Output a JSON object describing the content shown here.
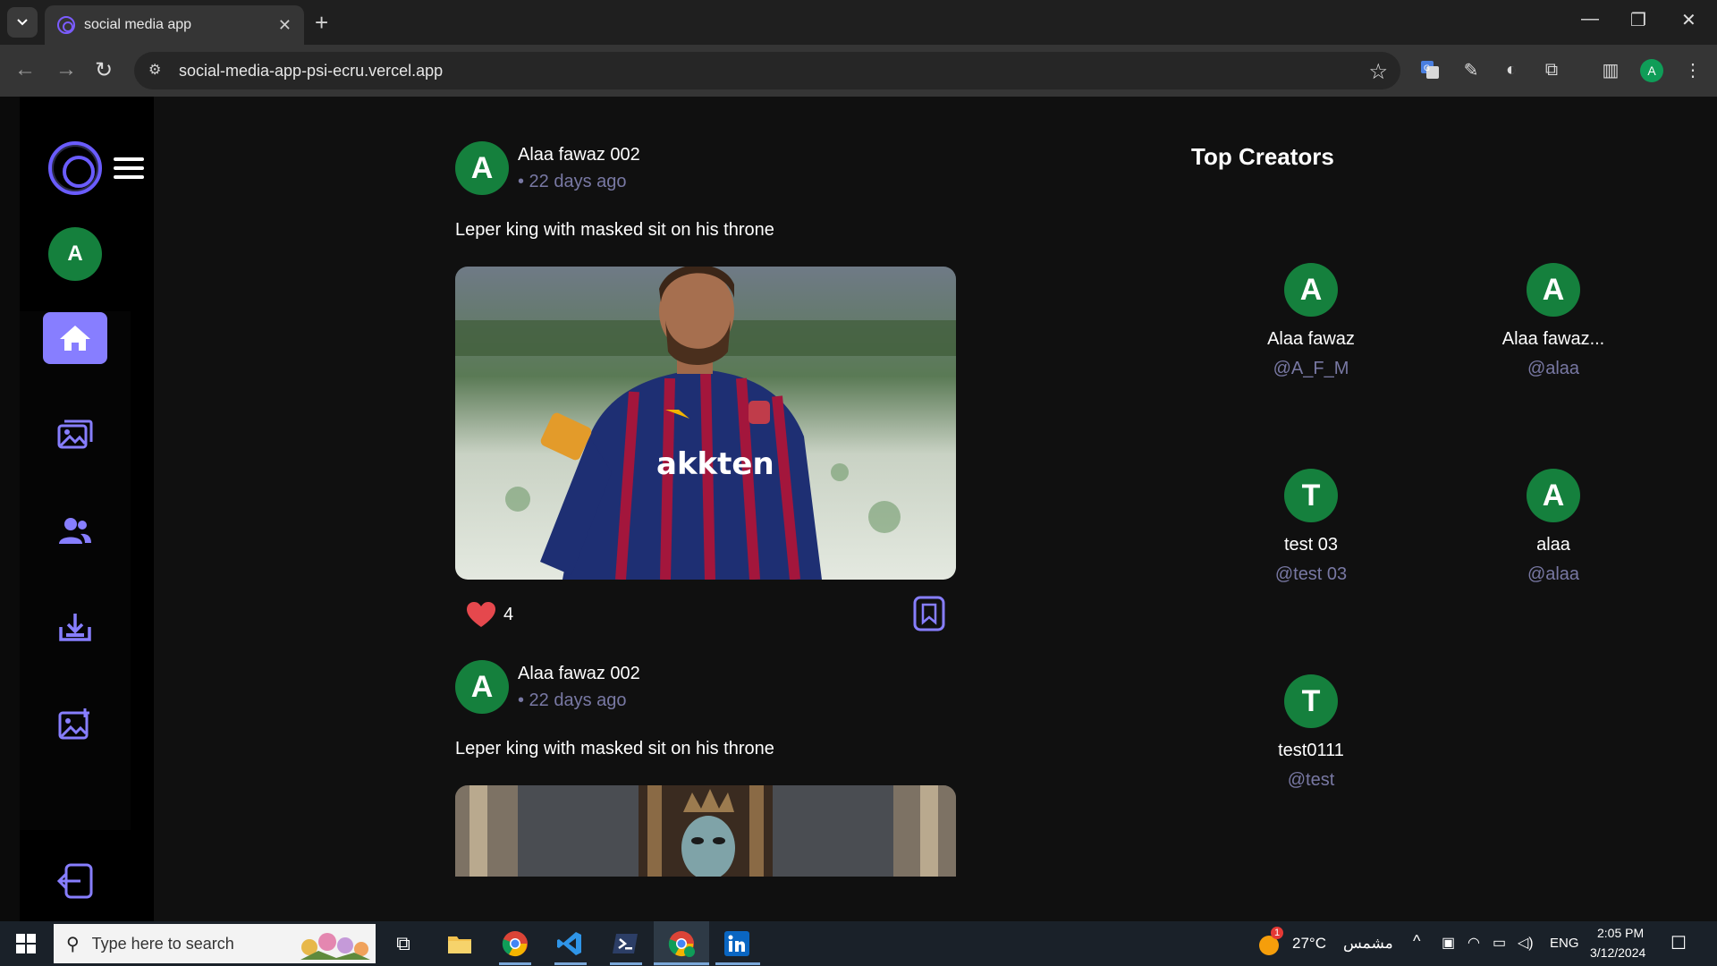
{
  "browser": {
    "tab_title": "social media app",
    "url": "social-media-app-psi-ecru.vercel.app",
    "profile_initial": "A"
  },
  "sidebar": {
    "user_initial": "A",
    "nav_items": [
      {
        "name": "home",
        "icon": "home-icon",
        "active": true
      },
      {
        "name": "explore",
        "icon": "gallery-icon",
        "active": false
      },
      {
        "name": "people",
        "icon": "people-icon",
        "active": false
      },
      {
        "name": "saved",
        "icon": "save-icon",
        "active": false
      },
      {
        "name": "create-post",
        "icon": "add-image-icon",
        "active": false
      }
    ]
  },
  "feed": {
    "posts": [
      {
        "author_initial": "A",
        "author": "Alaa fawaz 002",
        "time": "• 22 days ago",
        "caption": "Leper king with masked sit on his throne",
        "likes": "4"
      },
      {
        "author_initial": "A",
        "author": "Alaa fawaz 002",
        "time": "• 22 days ago",
        "caption": "Leper king with masked sit on his throne"
      }
    ]
  },
  "top_creators": {
    "title": "Top Creators",
    "creators": [
      {
        "initial": "A",
        "name": "Alaa fawaz",
        "handle": "@A_F_M"
      },
      {
        "initial": "A",
        "name": "Alaa fawaz...",
        "handle": "@alaa"
      },
      {
        "initial": "T",
        "name": "test 03",
        "handle": "@test 03"
      },
      {
        "initial": "A",
        "name": "alaa",
        "handle": "@alaa"
      },
      {
        "initial": "T",
        "name": "test0111",
        "handle": "@test"
      }
    ]
  },
  "taskbar": {
    "search_placeholder": "Type here to search",
    "weather_temp": "27°C",
    "weather_desc": "مشمس",
    "weather_badge": "1",
    "lang": "ENG",
    "time": "2:05 PM",
    "date": "3/12/2024"
  },
  "colors": {
    "accent": "#877eff",
    "avatar_bg": "#15803d",
    "muted_text": "#7878a3",
    "like_red": "#e5484d"
  }
}
